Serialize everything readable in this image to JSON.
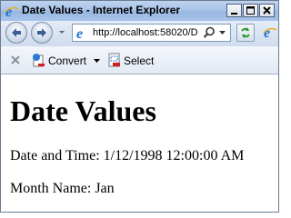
{
  "window": {
    "title": "Date Values - Internet Explorer"
  },
  "address_bar": {
    "url": "http://localhost:58020/D"
  },
  "command_bar": {
    "convert_label": "Convert",
    "select_label": "Select"
  },
  "page": {
    "heading": "Date Values",
    "date_time_text": "Date and Time: 1/12/1998 12:00:00 AM",
    "month_name_text": "Month Name: Jan"
  },
  "icons": {
    "browser": "ie-logo-icon",
    "back": "back-arrow-icon",
    "forward": "forward-arrow-icon",
    "search": "search-icon",
    "refresh": "refresh-icon",
    "close": "close-icon",
    "convert": "convert-pdf-icon",
    "select": "select-pdf-icon"
  },
  "colors": {
    "titlebar": "#a9c4e8",
    "link_blue": "#1f5fbf",
    "refresh_green": "#2e9a2e"
  }
}
